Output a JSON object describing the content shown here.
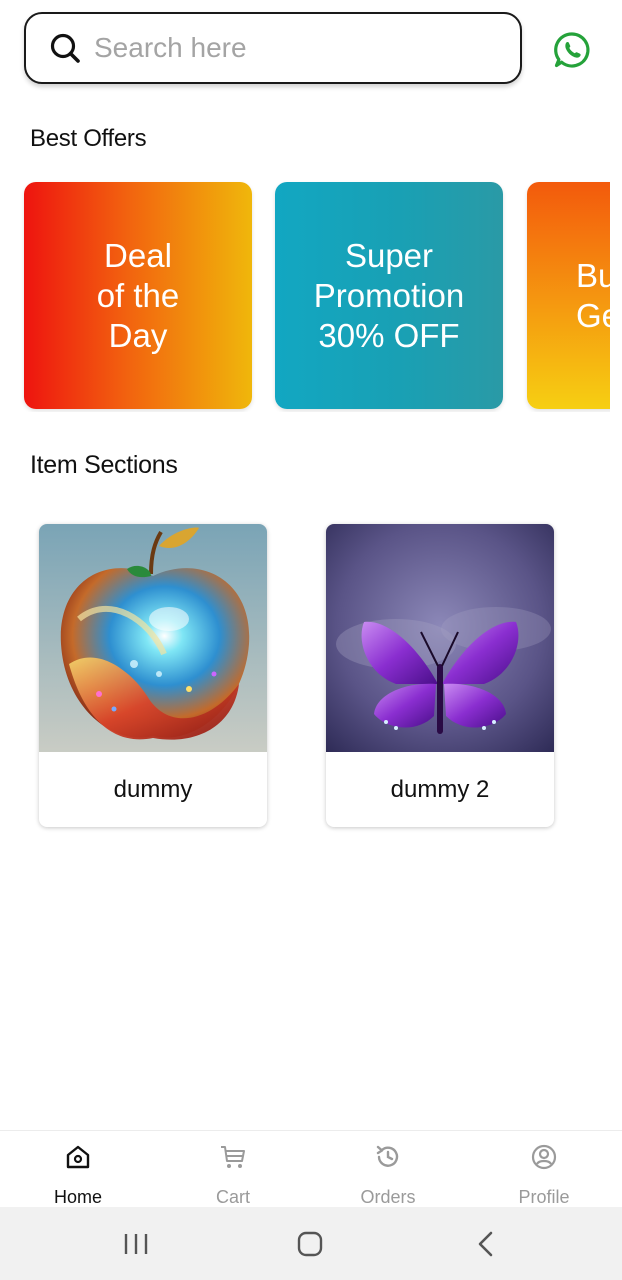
{
  "search": {
    "placeholder": "Search here",
    "value": ""
  },
  "header": {
    "whatsapp_icon": "whatsapp-icon",
    "whatsapp_color": "#25a23a"
  },
  "best_offers": {
    "title": "Best Offers",
    "cards": [
      {
        "text": "Deal\nof the\nDay",
        "colors": [
          "#ee140f",
          "#f0b70b"
        ]
      },
      {
        "text": "Super\nPromotion\n30% OFF",
        "colors": [
          "#12a7c2",
          "#2a9aa6"
        ]
      },
      {
        "text": "Bu\nGe",
        "colors": [
          "#f35a0c",
          "#f6cf12"
        ]
      }
    ]
  },
  "item_sections": {
    "title": "Item Sections",
    "items": [
      {
        "name": "dummy",
        "image": "colorful-glass-apple"
      },
      {
        "name": "dummy 2",
        "image": "purple-butterfly"
      }
    ]
  },
  "bottom_nav": {
    "items": [
      {
        "label": "Home",
        "icon": "home-icon",
        "active": true
      },
      {
        "label": "Cart",
        "icon": "cart-icon",
        "active": false
      },
      {
        "label": "Orders",
        "icon": "orders-history-icon",
        "active": false
      },
      {
        "label": "Profile",
        "icon": "profile-icon",
        "active": false
      }
    ]
  },
  "system_nav": {
    "recent": "recent-apps-icon",
    "home": "home-button-icon",
    "back": "back-icon"
  }
}
